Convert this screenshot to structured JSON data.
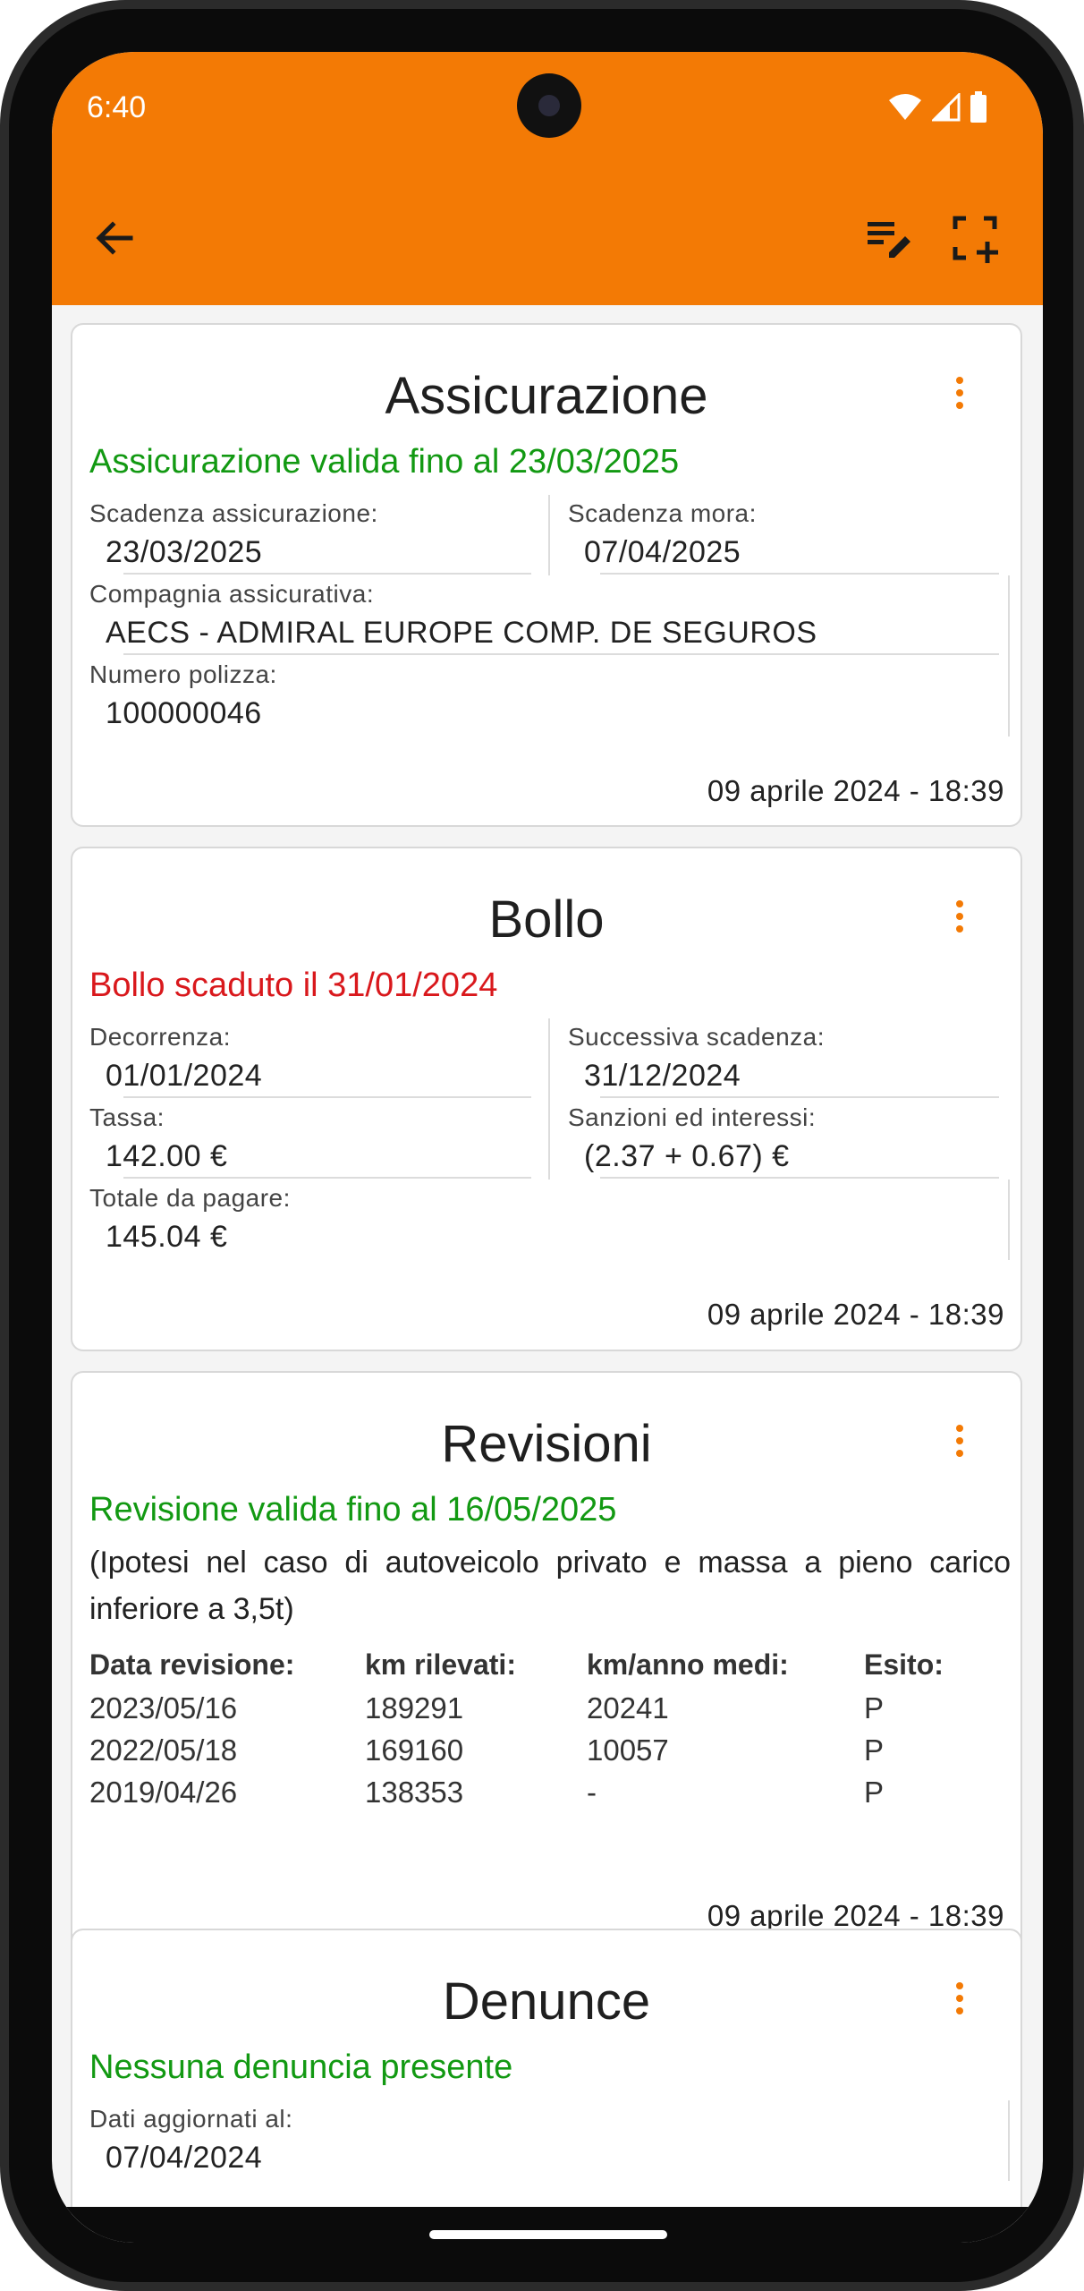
{
  "status_bar": {
    "time": "6:40"
  },
  "toolbar": {
    "back_icon": "arrow-back-icon",
    "edit_list_icon": "edit-list-icon",
    "scan_icon": "crop-add-icon"
  },
  "colors": {
    "accent": "#f37a05",
    "ok": "#129912",
    "error": "#d9181c"
  },
  "assicurazione": {
    "title": "Assicurazione",
    "status": "Assicurazione valida fino al 23/03/2025",
    "scadenza_label": "Scadenza assicurazione:",
    "scadenza_value": "23/03/2025",
    "mora_label": "Scadenza mora:",
    "mora_value": "07/04/2025",
    "compagnia_label": "Compagnia assicurativa:",
    "compagnia_value": "AECS - ADMIRAL EUROPE COMP. DE SEGUROS",
    "polizza_label": "Numero polizza:",
    "polizza_value": "100000046",
    "updated": "09 aprile 2024 - 18:39"
  },
  "bollo": {
    "title": "Bollo",
    "status": "Bollo scaduto il 31/01/2024",
    "decorrenza_label": "Decorrenza:",
    "decorrenza_value": "01/01/2024",
    "scadenza_label": "Successiva scadenza:",
    "scadenza_value": "31/12/2024",
    "tassa_label": "Tassa:",
    "tassa_value": "142.00 €",
    "sanzioni_label": "Sanzioni ed interessi:",
    "sanzioni_value": "(2.37 + 0.67) €",
    "totale_label": "Totale da pagare:",
    "totale_value": "145.04 €",
    "updated": "09 aprile 2024 - 18:39"
  },
  "revisioni": {
    "title": "Revisioni",
    "status": "Revisione valida fino al 16/05/2025",
    "note": "(Ipotesi nel caso di autoveicolo privato e massa a pieno carico inferiore a 3,5t)",
    "headers": [
      "Data revisione:",
      "km rilevati:",
      "km/anno medi:",
      "Esito:"
    ],
    "rows": [
      [
        "2023/05/16",
        "189291",
        "20241",
        "P"
      ],
      [
        "2022/05/18",
        "169160",
        "10057",
        "P"
      ],
      [
        "2019/04/26",
        "138353",
        "-",
        "P"
      ]
    ],
    "updated": "09 aprile 2024 - 18:39"
  },
  "denunce": {
    "title": "Denunce",
    "status": "Nessuna denuncia presente",
    "aggiornati_label": "Dati aggiornati al:",
    "aggiornati_value": "07/04/2024"
  }
}
